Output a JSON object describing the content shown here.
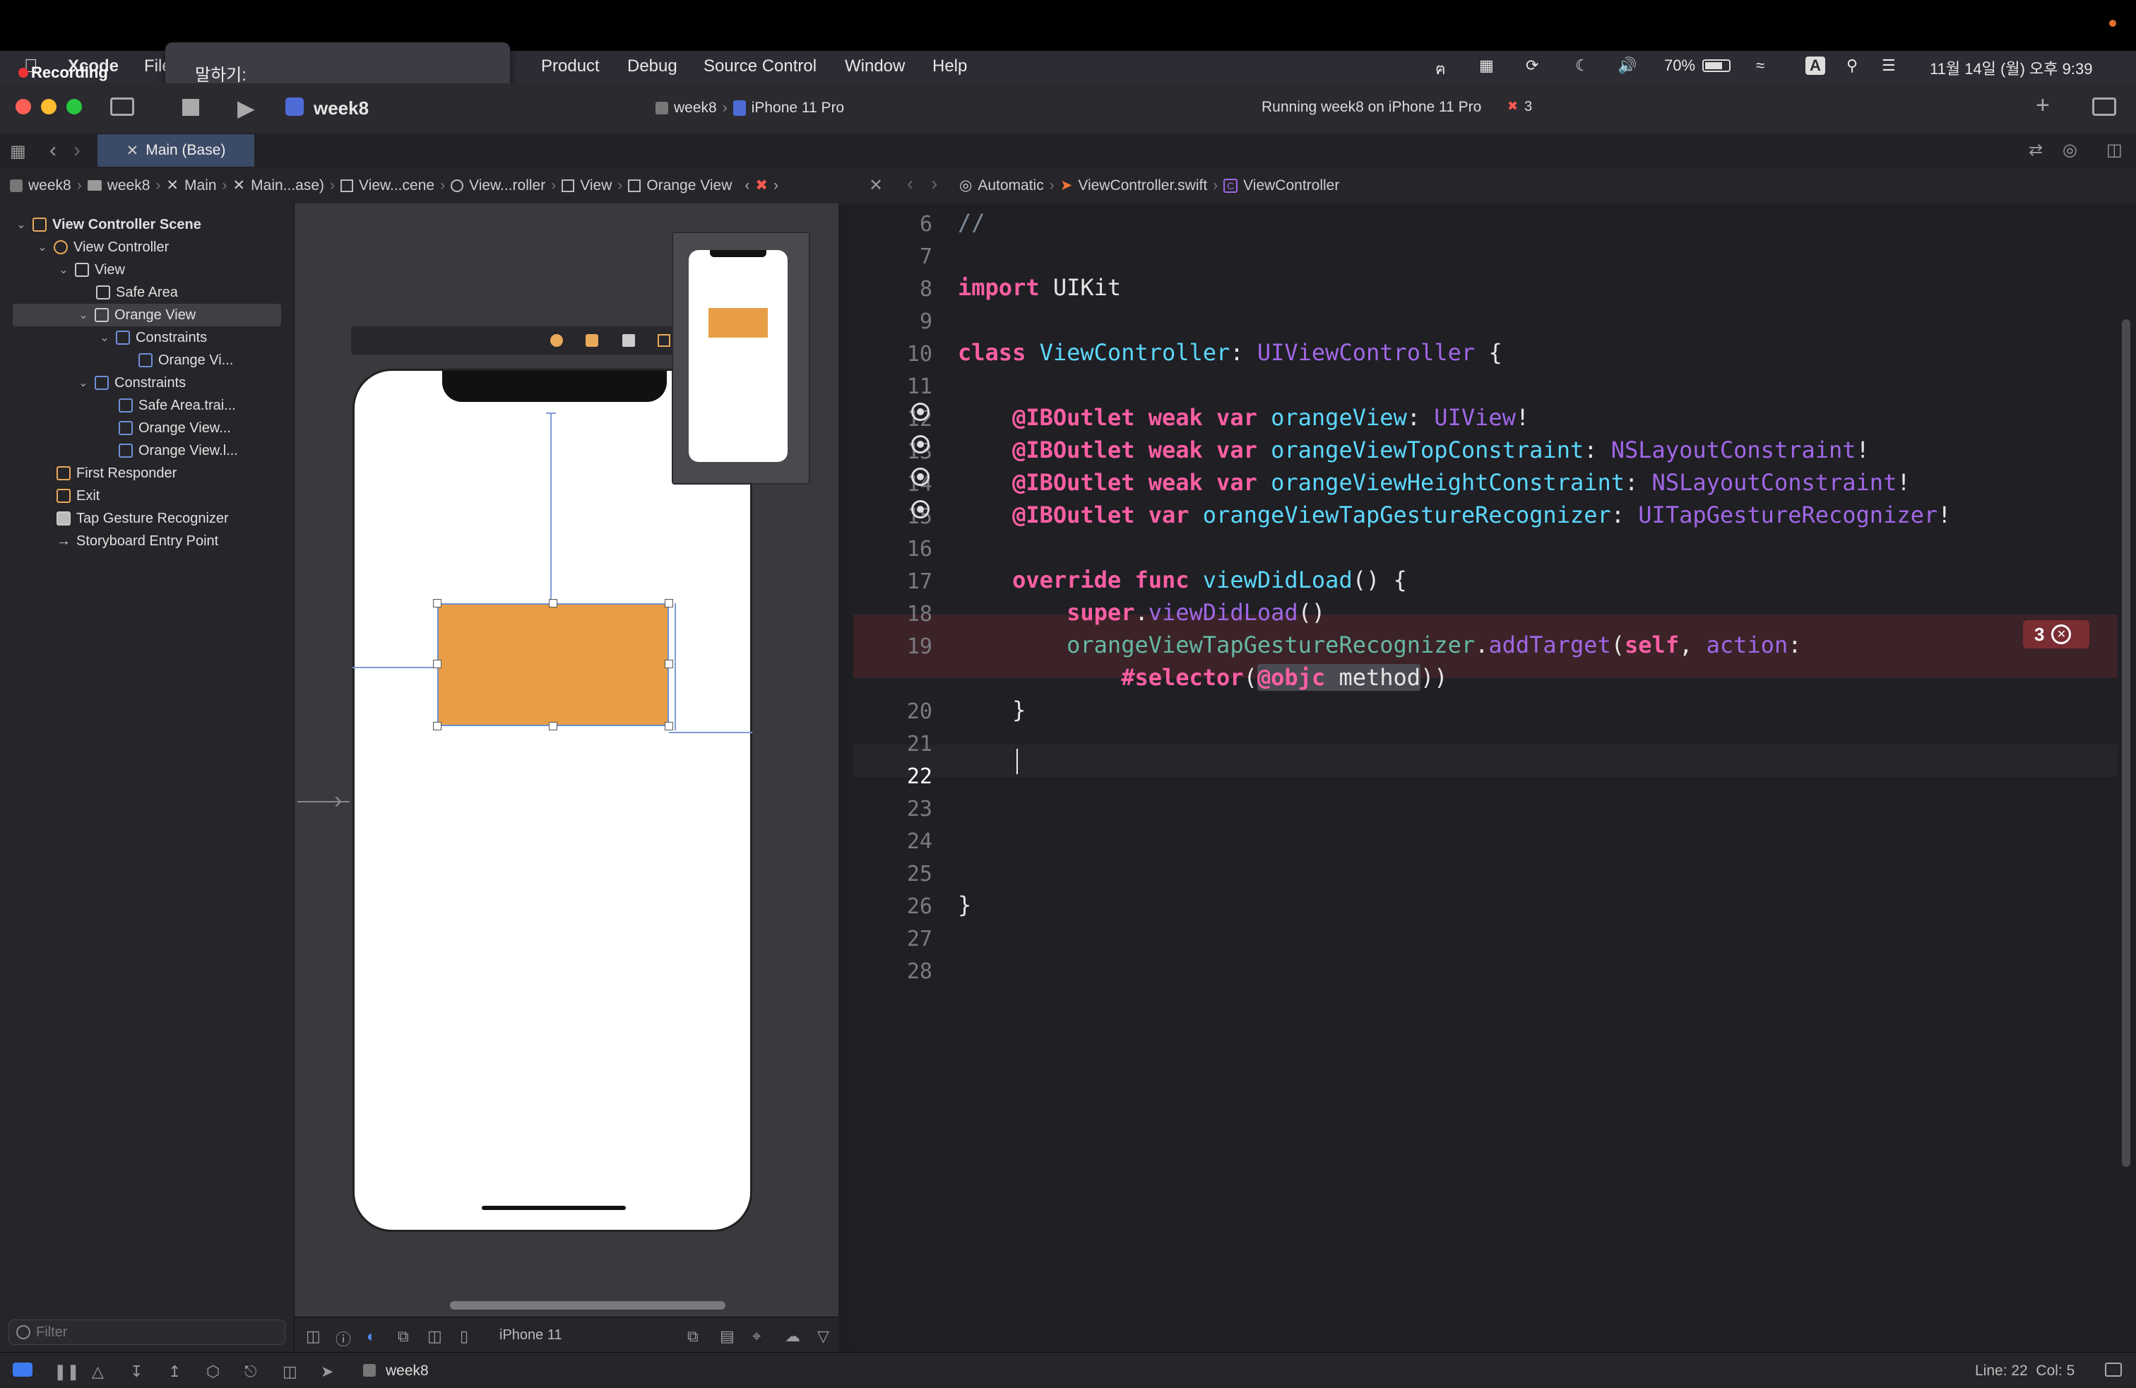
{
  "recording": {
    "label": "Recording"
  },
  "dictation": {
    "label": "말하기:"
  },
  "menubar": {
    "app": "Xcode",
    "items": [
      "File",
      "Product",
      "Debug",
      "Source Control",
      "Window",
      "Help"
    ],
    "battery": "70%",
    "input_method": "A",
    "clock": "11월 14일 (월) 오후 9:39"
  },
  "toolbar": {
    "scheme": "week8",
    "scheme_crumb": "week8",
    "device": "iPhone 11 Pro",
    "status": "Running week8 on iPhone 11 Pro",
    "error_count": "3"
  },
  "tab": {
    "label": "Main (Base)"
  },
  "breadcrumb_left": [
    "week8",
    "week8",
    "Main",
    "Main...ase)",
    "View...cene",
    "View...roller",
    "View",
    "Orange View"
  ],
  "breadcrumb_right": [
    "Automatic",
    "ViewController.swift",
    "ViewController"
  ],
  "outline": [
    {
      "label": "View Controller Scene",
      "bold": true
    },
    {
      "label": "View Controller"
    },
    {
      "label": "View"
    },
    {
      "label": "Safe Area"
    },
    {
      "label": "Orange View"
    },
    {
      "label": "Constraints"
    },
    {
      "label": "Orange Vi..."
    },
    {
      "label": "Constraints"
    },
    {
      "label": "Safe Area.trai..."
    },
    {
      "label": "Orange View..."
    },
    {
      "label": "Orange View.l..."
    },
    {
      "label": "First Responder"
    },
    {
      "label": "Exit"
    },
    {
      "label": "Tap Gesture Recognizer"
    },
    {
      "label": "Storyboard Entry Point"
    }
  ],
  "filter": {
    "placeholder": "Filter"
  },
  "canvas": {
    "device_label": "iPhone 11",
    "orange_color": "#e89e45"
  },
  "editor": {
    "line_numbers": [
      "6",
      "7",
      "8",
      "9",
      "10",
      "11",
      "12",
      "13",
      "14",
      "15",
      "16",
      "17",
      "18",
      "19",
      "",
      "20",
      "21",
      "22",
      "23",
      "24",
      "25",
      "26",
      "27",
      "28"
    ],
    "error_badge": "3"
  },
  "bottombar": {
    "scheme": "week8",
    "position": "Line: 22  Col: 5"
  }
}
